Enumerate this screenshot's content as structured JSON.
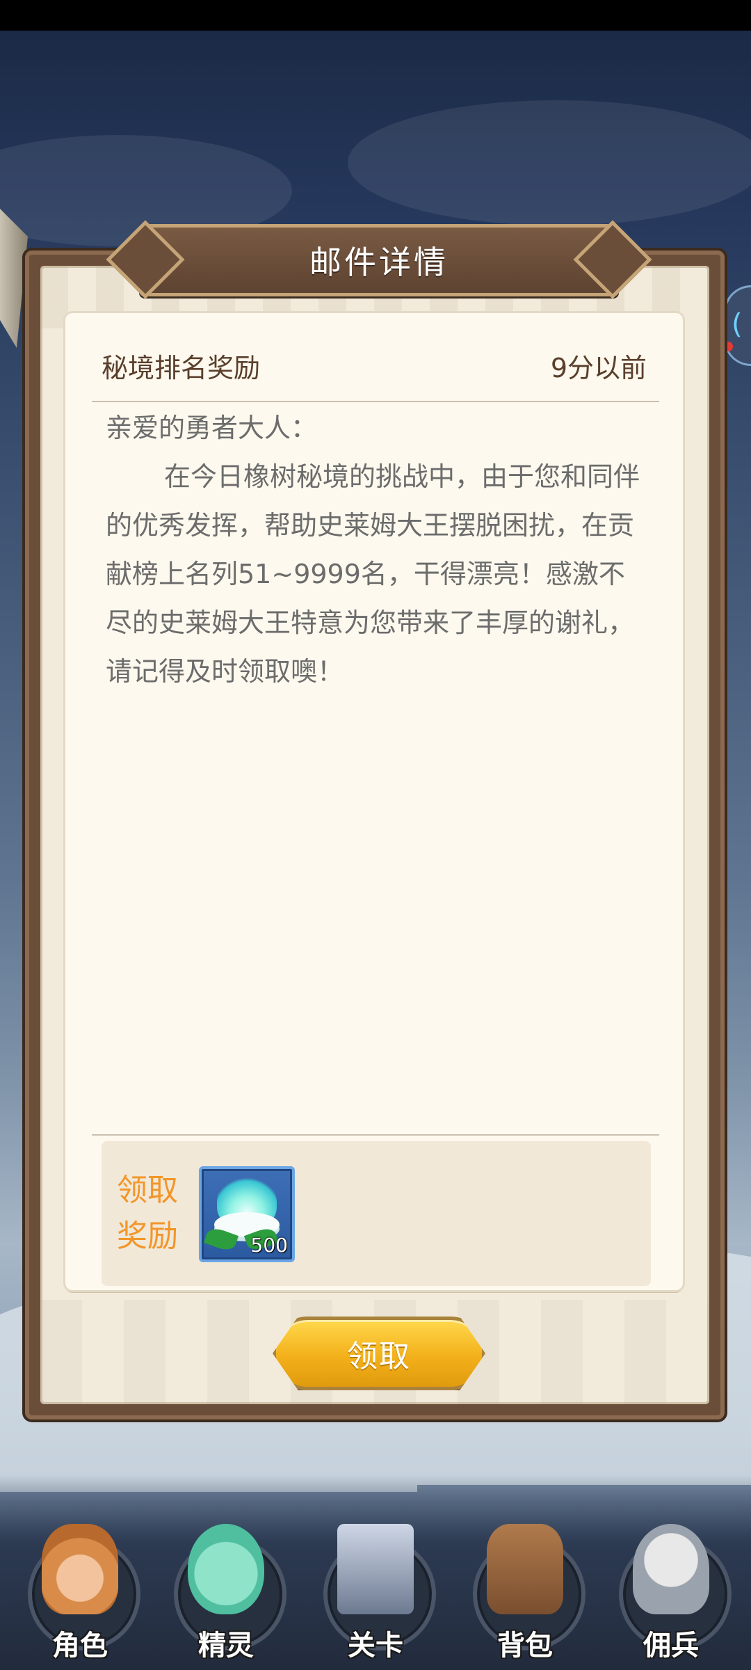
{
  "dialog": {
    "title": "邮件详情"
  },
  "mail": {
    "subject": "秘境排名奖励",
    "time": "9分以前",
    "greeting": "亲爱的勇者大人：",
    "body": "在今日橡树秘境的挑战中，由于您和同伴的优秀发挥，帮助史莱姆大王摆脱困扰，在贡献榜上名列51~9999名，干得漂亮！感激不尽的史莱姆大王特意为您带来了丰厚的谢礼，请记得及时领取噢！"
  },
  "reward": {
    "label": "领取奖励",
    "item_icon": "spirit-flame-bowl-icon",
    "quantity": "500"
  },
  "claim_button": {
    "label": "领取"
  },
  "bottom_nav": {
    "items": [
      {
        "label": "角色",
        "icon": "character-icon"
      },
      {
        "label": "精灵",
        "icon": "spirit-icon"
      },
      {
        "label": "关卡",
        "icon": "stage-icon"
      },
      {
        "label": "背包",
        "icon": "backpack-icon"
      },
      {
        "label": "佣兵",
        "icon": "mercenary-icon"
      }
    ]
  },
  "colors": {
    "accent_orange": "#f2962b",
    "frame_brown": "#6b4e39",
    "button_gold": "#f3b01a"
  }
}
